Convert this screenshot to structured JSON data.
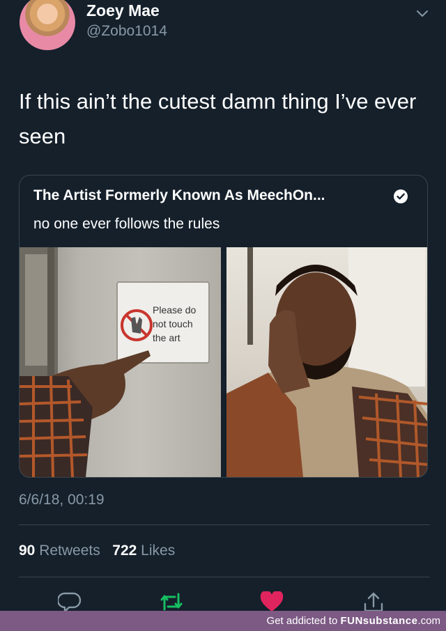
{
  "author": {
    "display_name": "Zoey Mae",
    "handle": "@Zobo1014"
  },
  "tweet": {
    "text": "If this ain’t the cutest damn thing I’ve ever seen",
    "timestamp": "6/6/18, 00:19"
  },
  "quoted_tweet": {
    "author_name": "The Artist Formerly Known As MeechOn...",
    "text": "no one ever follows the rules",
    "sign_text": [
      "Please do",
      "not touch",
      "the art"
    ]
  },
  "stats": {
    "retweets_count": "90",
    "retweets_label": "Retweets",
    "likes_count": "722",
    "likes_label": "Likes"
  },
  "actions": [
    "reply-icon",
    "retweet-icon",
    "like-icon",
    "share-icon"
  ],
  "footer": {
    "prefix": "Get addicted to ",
    "brand": "FUNsubstance",
    "suffix": ".com"
  },
  "colors": {
    "background": "#15202b",
    "secondary_text": "#8899a6",
    "retweet_green": "#17bf63",
    "like_red": "#e0245e",
    "footer_purple": "#7c5a84"
  }
}
